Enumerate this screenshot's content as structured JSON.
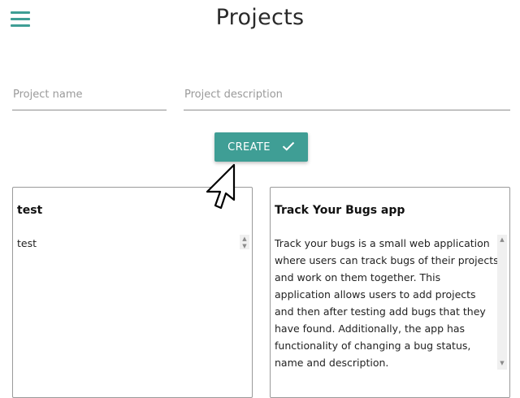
{
  "header": {
    "title": "Projects",
    "menu_icon": "hamburger-menu-icon"
  },
  "form": {
    "name_placeholder": "Project name",
    "description_placeholder": "Project description",
    "name_value": "",
    "description_value": "",
    "create_label": "CREATE",
    "create_icon": "check-icon"
  },
  "cards": [
    {
      "title": "test",
      "description": "test"
    },
    {
      "title": "Track Your Bugs app",
      "description_lines": [
        "Track your bugs is a small web application",
        "where users can track bugs of their projects",
        "and work on them together. This",
        "application allows users to add projects",
        "and then after testing add bugs that they",
        "have found. Additionally, the app has",
        "functionality of changing a bug status,",
        "name and description."
      ]
    }
  ],
  "colors": {
    "accent": "#3f9e95",
    "border": "#9a9a9a",
    "text": "#222222"
  }
}
